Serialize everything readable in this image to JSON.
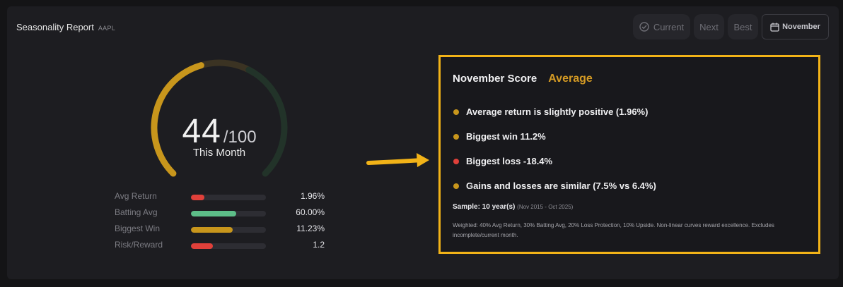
{
  "header": {
    "title": "Seasonality Report",
    "ticker": "AAPL"
  },
  "nav": {
    "current_label": "Current",
    "next_label": "Next",
    "best_label": "Best",
    "month_label": "November"
  },
  "gauge": {
    "score": "44",
    "max": "/100",
    "label": "This Month",
    "fill_fraction": 0.44,
    "colors": {
      "fill": "#c8961c",
      "track_warm": "#3b3323",
      "track_cool": "#223329"
    }
  },
  "metrics": [
    {
      "label": "Avg Return",
      "value": "1.96%",
      "fill": 0.18,
      "color": "#e0403a"
    },
    {
      "label": "Batting Avg",
      "value": "60.00%",
      "fill": 0.6,
      "color": "#5dbe88"
    },
    {
      "label": "Biggest Win",
      "value": "11.23%",
      "fill": 0.56,
      "color": "#c8961c"
    },
    {
      "label": "Risk/Reward",
      "value": "1.2",
      "fill": 0.29,
      "color": "#e0403a"
    }
  ],
  "score_card": {
    "title": "November Score",
    "rating": "Average",
    "bullets": [
      {
        "text": "Average return is slightly positive (1.96%)",
        "color": "#c8961c"
      },
      {
        "text": "Biggest win 11.2%",
        "color": "#c8961c"
      },
      {
        "text": "Biggest loss -18.4%",
        "color": "#e0403a"
      },
      {
        "text": "Gains and losses are similar (7.5% vs 6.4%)",
        "color": "#c8961c"
      }
    ],
    "sample_label": "Sample: 10 year(s)",
    "sample_range": "(Nov 2015 - Oct 2025)",
    "note": "Weighted: 40% Avg Return, 30% Batting Avg, 20% Loss Protection, 10% Upside. Non-linear curves reward excellence. Excludes incomplete/current month."
  },
  "colors": {
    "accent": "#f2b318",
    "panel": "#1d1d21"
  }
}
